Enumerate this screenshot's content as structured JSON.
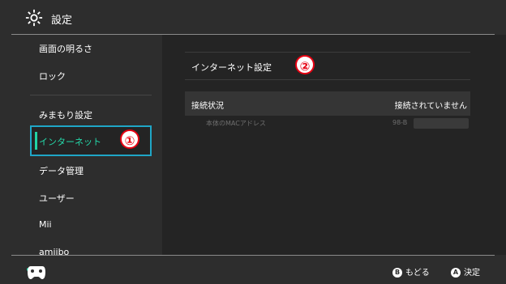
{
  "header": {
    "title": "設定",
    "icon": "gear-icon"
  },
  "sidebar": {
    "items": [
      {
        "label": "画面の明るさ"
      },
      {
        "label": "ロック"
      },
      {
        "label": "みまもり設定"
      },
      {
        "label": "インターネット",
        "selected": true
      },
      {
        "label": "データ管理"
      },
      {
        "label": "ユーザー"
      },
      {
        "label": "Mii"
      },
      {
        "label": "amiibo"
      }
    ]
  },
  "main": {
    "title": "インターネット設定",
    "status_label": "接続状況",
    "status_value": "接続されていません",
    "mac_label": "本体のMACアドレス",
    "mac_value": "98-B"
  },
  "annotations": {
    "badge1": "①",
    "badge2": "②"
  },
  "footer": {
    "back_key": "B",
    "back_label": "もどる",
    "ok_key": "A",
    "ok_label": "決定"
  },
  "colors": {
    "background": "#2d2d2d",
    "panel": "#242424",
    "accent_selected": "#21d3a4",
    "focus_border": "#1fa6c7",
    "annotation_red": "#e60012"
  }
}
